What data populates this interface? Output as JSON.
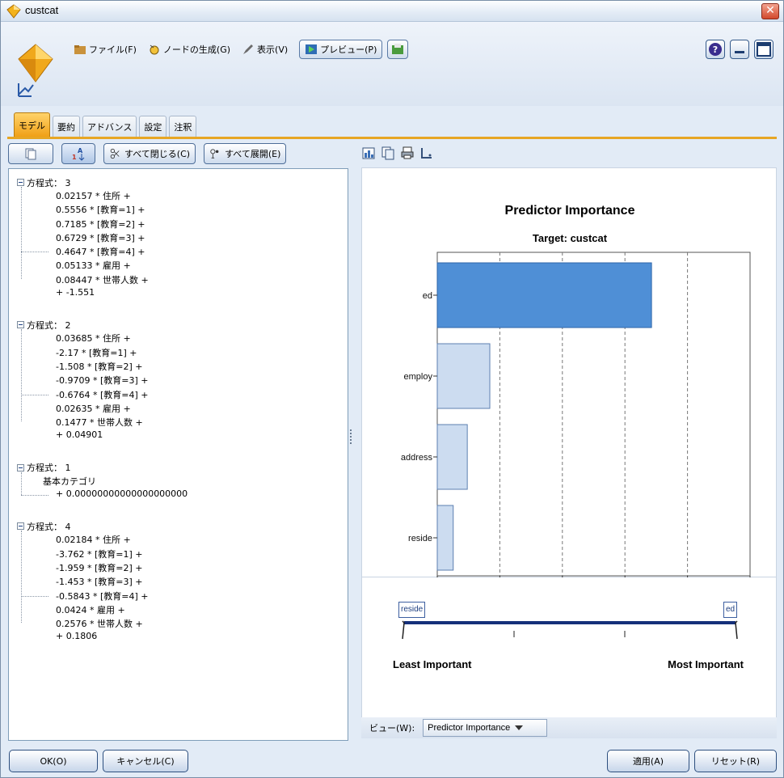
{
  "window": {
    "title": "custcat"
  },
  "toolbar": {
    "file": "ファイル(F)",
    "generate": "ノードの生成(G)",
    "view": "表示(V)",
    "preview": "プレビュー(P)"
  },
  "tabs": [
    {
      "label": "モデル",
      "active": true
    },
    {
      "label": "要約"
    },
    {
      "label": "アドバンス"
    },
    {
      "label": "設定"
    },
    {
      "label": "注釈"
    }
  ],
  "left_toolbar": {
    "collapse_all": "すべて閉じる(C)",
    "expand_all": "すべて展開(E)"
  },
  "equations": [
    {
      "head": "方程式： 3",
      "terms": [
        "0.02157 * 住所 +",
        "0.5556 * [教育=1] +",
        "0.7185 * [教育=2] +",
        "0.6729 * [教育=3] +",
        "0.4647 * [教育=4] +",
        "0.05133 * 雇用 +",
        "0.08447 * 世帯人数 +",
        "+ -1.551"
      ]
    },
    {
      "head": "方程式： 2",
      "terms": [
        "0.03685 * 住所 +",
        "-2.17 * [教育=1] +",
        "-1.508 * [教育=2] +",
        "-0.9709 * [教育=3] +",
        "-0.6764 * [教育=4] +",
        "0.02635 * 雇用 +",
        "0.1477 * 世帯人数 +",
        "+ 0.04901"
      ]
    },
    {
      "head": "方程式： 1",
      "terms": [
        "基本カテゴリ",
        "+ 0.00000000000000000000"
      ]
    },
    {
      "head": "方程式： 4",
      "terms": [
        "0.02184 * 住所 +",
        "-3.762 * [教育=1] +",
        "-1.959 * [教育=2] +",
        "-1.453 * [教育=3] +",
        "-0.5843 * [教育=4] +",
        "0.0424 * 雇用 +",
        "0.2576 * 世帯人数 +",
        "+ 0.1806"
      ]
    }
  ],
  "chart_data": {
    "type": "bar",
    "orientation": "horizontal",
    "title": "Predictor Importance",
    "subtitle": "Target: custcat",
    "categories": [
      "ed",
      "employ",
      "address",
      "reside"
    ],
    "values": [
      0.685,
      0.168,
      0.096,
      0.051
    ],
    "xlim": [
      0,
      1
    ],
    "xticks": [
      "0.0",
      "0.2",
      "0.4",
      "0.6",
      "0.8",
      "1.0"
    ],
    "gridlines": [
      0.2,
      0.4,
      0.6,
      0.8
    ],
    "colors": {
      "top_bar": "#4f8fd6",
      "other_bars": "#ccdcf0"
    }
  },
  "importance_slider": {
    "min_label": "reside",
    "max_label": "ed",
    "least_label": "Least Important",
    "most_label": "Most Important"
  },
  "view": {
    "label": "ビュー(W):",
    "selected": "Predictor Importance"
  },
  "footer": {
    "ok": "OK(O)",
    "cancel": "キャンセル(C)",
    "apply": "適用(A)",
    "reset": "リセット(R)"
  }
}
